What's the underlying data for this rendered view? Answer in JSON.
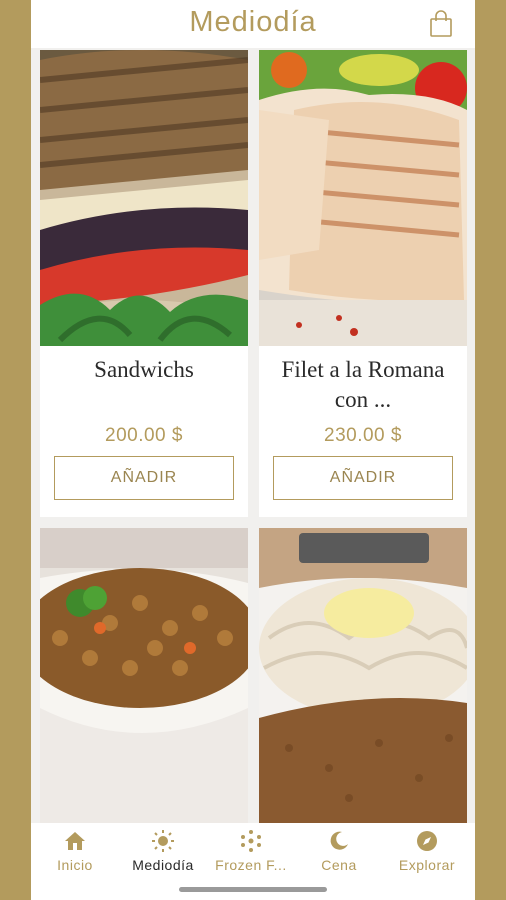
{
  "header": {
    "title": "Mediodía",
    "cart_icon": "shopping-bag-icon"
  },
  "products": [
    {
      "name": "Sandwichs",
      "price": "200.00 $",
      "add_label": "AÑADIR",
      "image": "grilled-vegetable-sandwich"
    },
    {
      "name": "Filet a la Romana con ...",
      "price": "230.00 $",
      "add_label": "AÑADIR",
      "image": "grilled-fish-fillet"
    },
    {
      "name": "",
      "price": "",
      "add_label": "",
      "image": "lentil-stew-bowl"
    },
    {
      "name": "",
      "price": "",
      "add_label": "",
      "image": "milanesa-with-cheese-rice"
    }
  ],
  "tabs": [
    {
      "label": "Inicio",
      "icon": "home-icon"
    },
    {
      "label": "Mediodía",
      "icon": "sun-icon",
      "active": true
    },
    {
      "label": "Frozen F...",
      "icon": "snowflake-icon"
    },
    {
      "label": "Cena",
      "icon": "moon-icon"
    },
    {
      "label": "Explorar",
      "icon": "compass-icon"
    }
  ],
  "colors": {
    "accent": "#b39b5d",
    "background": "#f1f0ee",
    "text": "#2a2a2a"
  }
}
